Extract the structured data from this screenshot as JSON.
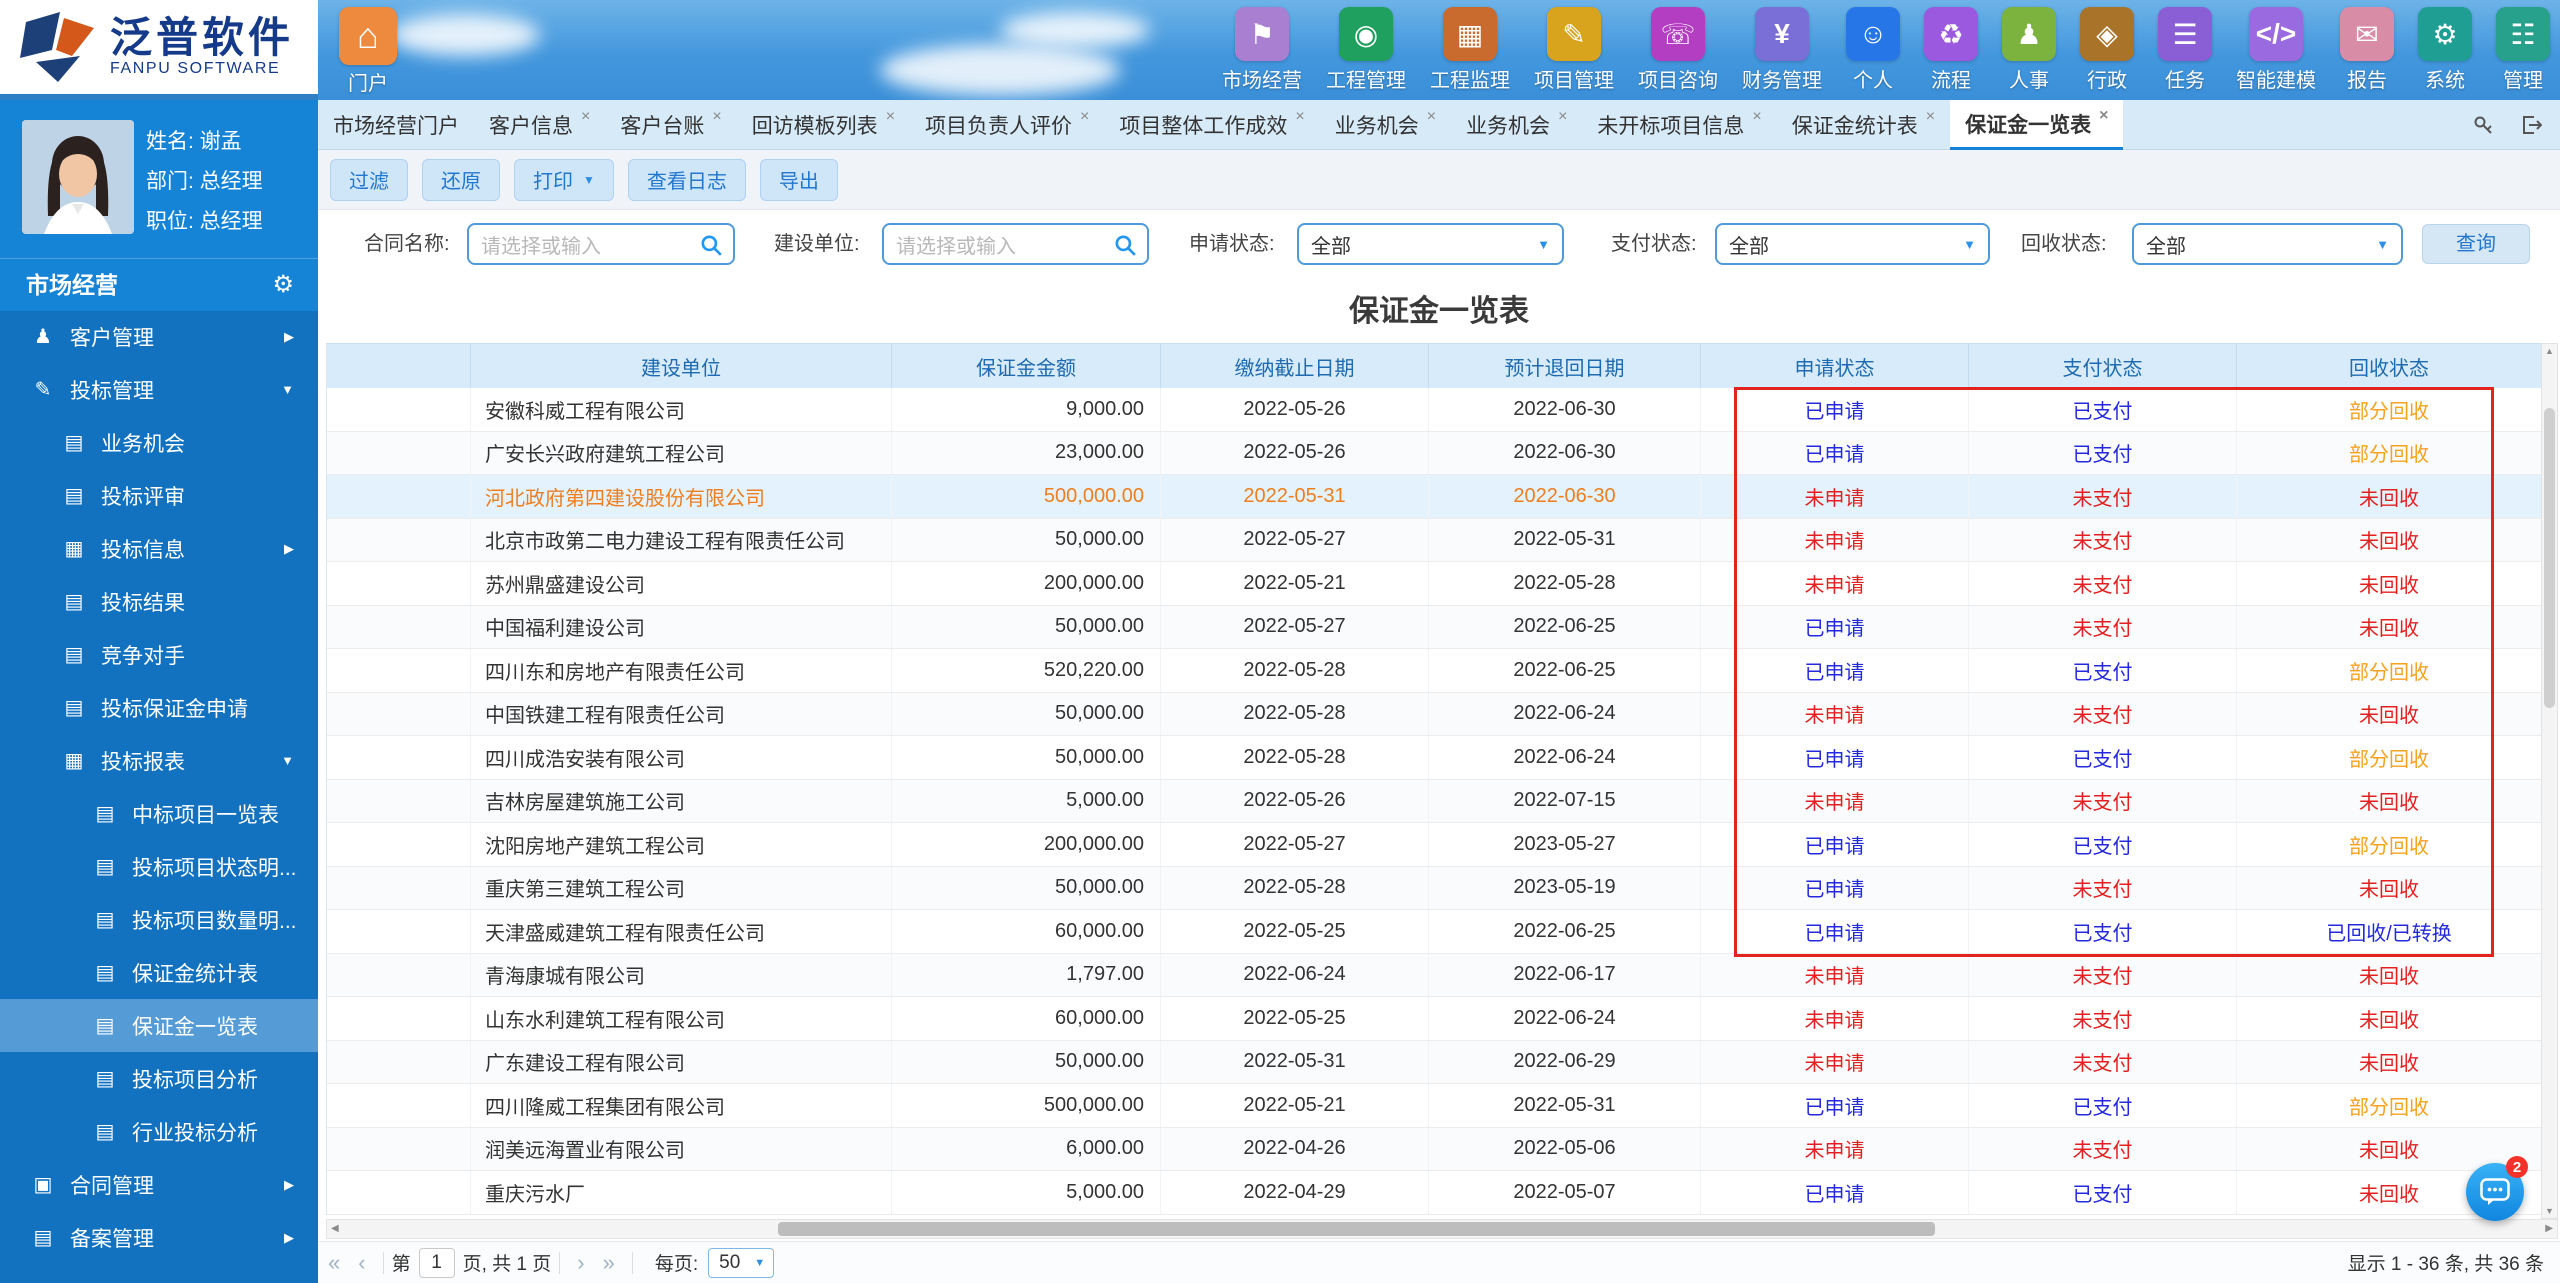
{
  "brand": {
    "logo_cn": "泛普软件",
    "logo_en": "FANPU SOFTWARE"
  },
  "topnav": {
    "portal": {
      "label": "门户",
      "color": "#ed8a3d",
      "glyph": "⌂"
    },
    "items": [
      {
        "label": "市场经营",
        "color": "#a87fd1",
        "glyph": "⚑"
      },
      {
        "label": "工程管理",
        "color": "#1fa05e",
        "glyph": "◉"
      },
      {
        "label": "工程监理",
        "color": "#c96a2e",
        "glyph": "▦"
      },
      {
        "label": "项目管理",
        "color": "#d8a31d",
        "glyph": "✎"
      },
      {
        "label": "项目咨询",
        "color": "#b43ec2",
        "glyph": "☏"
      },
      {
        "label": "财务管理",
        "color": "#7a6fd6",
        "glyph": "¥"
      },
      {
        "label": "个人",
        "color": "#2676e8",
        "glyph": "☺"
      },
      {
        "label": "流程",
        "color": "#9b59e0",
        "glyph": "♻"
      },
      {
        "label": "人事",
        "color": "#7cb23e",
        "glyph": "♟"
      },
      {
        "label": "行政",
        "color": "#a9742a",
        "glyph": "◈"
      },
      {
        "label": "任务",
        "color": "#8a5fd6",
        "glyph": "☰"
      },
      {
        "label": "智能建模",
        "color": "#9a6ae0",
        "glyph": "</>"
      },
      {
        "label": "报告",
        "color": "#d98ca6",
        "glyph": "✉"
      },
      {
        "label": "系统",
        "color": "#1f9e93",
        "glyph": "⚙"
      },
      {
        "label": "管理",
        "color": "#27a08c",
        "glyph": "☷"
      }
    ]
  },
  "user": {
    "name_label": "姓名: 谢孟",
    "dept_label": "部门: 总经理",
    "title_label": "职位: 总经理"
  },
  "sidebar": {
    "section": "市场经营",
    "items": [
      {
        "label": "客户管理",
        "level": 1,
        "icon": "♟",
        "icon_name": "customer-icon",
        "arrow": "right"
      },
      {
        "label": "投标管理",
        "level": 1,
        "icon": "✎",
        "icon_name": "edit-icon",
        "arrow": "down"
      },
      {
        "label": "业务机会",
        "level": 2,
        "icon": "▤",
        "icon_name": "file-icon"
      },
      {
        "label": "投标评审",
        "level": 2,
        "icon": "▤",
        "icon_name": "file-icon"
      },
      {
        "label": "投标信息",
        "level": 2,
        "icon": "▦",
        "icon_name": "grid-icon",
        "arrow": "right"
      },
      {
        "label": "投标结果",
        "level": 2,
        "icon": "▤",
        "icon_name": "file-icon"
      },
      {
        "label": "竞争对手",
        "level": 2,
        "icon": "▤",
        "icon_name": "file-icon"
      },
      {
        "label": "投标保证金申请",
        "level": 2,
        "icon": "▤",
        "icon_name": "file-icon"
      },
      {
        "label": "投标报表",
        "level": 2,
        "icon": "▦",
        "icon_name": "grid-icon",
        "arrow": "down"
      },
      {
        "label": "中标项目一览表",
        "level": 3,
        "icon": "▤",
        "icon_name": "file-icon"
      },
      {
        "label": "投标项目状态明...",
        "level": 3,
        "icon": "▤",
        "icon_name": "file-icon"
      },
      {
        "label": "投标项目数量明...",
        "level": 3,
        "icon": "▤",
        "icon_name": "file-icon"
      },
      {
        "label": "保证金统计表",
        "level": 3,
        "icon": "▤",
        "icon_name": "file-icon"
      },
      {
        "label": "保证金一览表",
        "level": 3,
        "icon": "▤",
        "icon_name": "file-icon",
        "selected": true
      },
      {
        "label": "投标项目分析",
        "level": 3,
        "icon": "▤",
        "icon_name": "file-icon"
      },
      {
        "label": "行业投标分析",
        "level": 3,
        "icon": "▤",
        "icon_name": "file-icon"
      },
      {
        "label": "合同管理",
        "level": 1,
        "icon": "▣",
        "icon_name": "contract-icon",
        "arrow": "right"
      },
      {
        "label": "备案管理",
        "level": 1,
        "icon": "▤",
        "icon_name": "file-icon",
        "arrow": "right"
      }
    ]
  },
  "tabbar": {
    "tabs": [
      {
        "label": "市场经营门户",
        "closable": false,
        "active": false
      },
      {
        "label": "客户信息",
        "closable": true,
        "active": false
      },
      {
        "label": "客户台账",
        "closable": true,
        "active": false
      },
      {
        "label": "回访模板列表",
        "closable": true,
        "active": false
      },
      {
        "label": "项目负责人评价",
        "closable": true,
        "active": false
      },
      {
        "label": "项目整体工作成效",
        "closable": true,
        "active": false
      },
      {
        "label": "业务机会",
        "closable": true,
        "active": false
      },
      {
        "label": "业务机会",
        "closable": true,
        "active": false
      },
      {
        "label": "未开标项目信息",
        "closable": true,
        "active": false
      },
      {
        "label": "保证金统计表",
        "closable": true,
        "active": false
      },
      {
        "label": "保证金一览表",
        "closable": true,
        "active": true
      }
    ]
  },
  "toolbar": {
    "buttons": [
      {
        "label": "过滤",
        "caret": false
      },
      {
        "label": "还原",
        "caret": false
      },
      {
        "label": "打印",
        "caret": true
      },
      {
        "label": "查看日志",
        "caret": false
      },
      {
        "label": "导出",
        "caret": false
      }
    ]
  },
  "filters": {
    "contract_label": "合同名称:",
    "contract_placeholder": "请选择或输入",
    "unit_label": "建设单位:",
    "unit_placeholder": "请选择或输入",
    "apply_label": "申请状态:",
    "apply_value": "全部",
    "pay_label": "支付状态:",
    "pay_value": "全部",
    "recover_label": "回收状态:",
    "recover_value": "全部",
    "search_button": "查询"
  },
  "page_title": "保证金一览表",
  "table": {
    "columns": [
      "",
      "建设单位",
      "保证金金额",
      "缴纳截止日期",
      "预计退回日期",
      "申请状态",
      "支付状态",
      "回收状态"
    ],
    "rows": [
      {
        "company": "安徽科威工程有限公司",
        "amount": "9,000.00",
        "deadline": "2022-05-26",
        "return_date": "2022-06-30",
        "apply": "已申请",
        "pay": "已支付",
        "recover": "部分回收",
        "highlight": false
      },
      {
        "company": "广安长兴政府建筑工程公司",
        "amount": "23,000.00",
        "deadline": "2022-05-26",
        "return_date": "2022-06-30",
        "apply": "已申请",
        "pay": "已支付",
        "recover": "部分回收",
        "highlight": false
      },
      {
        "company": "河北政府第四建设股份有限公司",
        "amount": "500,000.00",
        "deadline": "2022-05-31",
        "return_date": "2022-06-30",
        "apply": "未申请",
        "pay": "未支付",
        "recover": "未回收",
        "highlight": true
      },
      {
        "company": "北京市政第二电力建设工程有限责任公司",
        "amount": "50,000.00",
        "deadline": "2022-05-27",
        "return_date": "2022-05-31",
        "apply": "未申请",
        "pay": "未支付",
        "recover": "未回收",
        "highlight": false
      },
      {
        "company": "苏州鼎盛建设公司",
        "amount": "200,000.00",
        "deadline": "2022-05-21",
        "return_date": "2022-05-28",
        "apply": "未申请",
        "pay": "未支付",
        "recover": "未回收",
        "highlight": false
      },
      {
        "company": "中国福利建设公司",
        "amount": "50,000.00",
        "deadline": "2022-05-27",
        "return_date": "2022-06-25",
        "apply": "已申请",
        "pay": "未支付",
        "recover": "未回收",
        "highlight": false
      },
      {
        "company": "四川东和房地产有限责任公司",
        "amount": "520,220.00",
        "deadline": "2022-05-28",
        "return_date": "2022-06-25",
        "apply": "已申请",
        "pay": "已支付",
        "recover": "部分回收",
        "highlight": false
      },
      {
        "company": "中国铁建工程有限责任公司",
        "amount": "50,000.00",
        "deadline": "2022-05-28",
        "return_date": "2022-06-24",
        "apply": "未申请",
        "pay": "未支付",
        "recover": "未回收",
        "highlight": false
      },
      {
        "company": "四川成浩安装有限公司",
        "amount": "50,000.00",
        "deadline": "2022-05-28",
        "return_date": "2022-06-24",
        "apply": "已申请",
        "pay": "已支付",
        "recover": "部分回收",
        "highlight": false
      },
      {
        "company": "吉林房屋建筑施工公司",
        "amount": "5,000.00",
        "deadline": "2022-05-26",
        "return_date": "2022-07-15",
        "apply": "未申请",
        "pay": "未支付",
        "recover": "未回收",
        "highlight": false
      },
      {
        "company": "沈阳房地产建筑工程公司",
        "amount": "200,000.00",
        "deadline": "2022-05-27",
        "return_date": "2023-05-27",
        "apply": "已申请",
        "pay": "已支付",
        "recover": "部分回收",
        "highlight": false
      },
      {
        "company": "重庆第三建筑工程公司",
        "amount": "50,000.00",
        "deadline": "2022-05-28",
        "return_date": "2023-05-19",
        "apply": "已申请",
        "pay": "未支付",
        "recover": "未回收",
        "highlight": false
      },
      {
        "company": "天津盛威建筑工程有限责任公司",
        "amount": "60,000.00",
        "deadline": "2022-05-25",
        "return_date": "2022-06-25",
        "apply": "已申请",
        "pay": "已支付",
        "recover": "已回收/已转换",
        "highlight": false
      },
      {
        "company": "青海康城有限公司",
        "amount": "1,797.00",
        "deadline": "2022-06-24",
        "return_date": "2022-06-17",
        "apply": "未申请",
        "pay": "未支付",
        "recover": "未回收",
        "highlight": false
      },
      {
        "company": "山东水利建筑工程有限公司",
        "amount": "60,000.00",
        "deadline": "2022-05-25",
        "return_date": "2022-06-24",
        "apply": "未申请",
        "pay": "未支付",
        "recover": "未回收",
        "highlight": false
      },
      {
        "company": "广东建设工程有限公司",
        "amount": "50,000.00",
        "deadline": "2022-05-31",
        "return_date": "2022-06-29",
        "apply": "未申请",
        "pay": "未支付",
        "recover": "未回收",
        "highlight": false
      },
      {
        "company": "四川隆威工程集团有限公司",
        "amount": "500,000.00",
        "deadline": "2022-05-21",
        "return_date": "2022-05-31",
        "apply": "已申请",
        "pay": "已支付",
        "recover": "部分回收",
        "highlight": false
      },
      {
        "company": "润美远海置业有限公司",
        "amount": "6,000.00",
        "deadline": "2022-04-26",
        "return_date": "2022-05-06",
        "apply": "未申请",
        "pay": "未支付",
        "recover": "未回收",
        "highlight": false
      },
      {
        "company": "重庆污水厂",
        "amount": "5,000.00",
        "deadline": "2022-04-29",
        "return_date": "2022-05-07",
        "apply": "已申请",
        "pay": "已支付",
        "recover": "未回收",
        "highlight": false
      }
    ]
  },
  "pagination": {
    "first": "«",
    "prev": "‹",
    "page_prefix": "第",
    "page_value": "1",
    "page_suffix": "页, 共 1 页",
    "next": "›",
    "last": "»",
    "per_page_label": "每页:",
    "per_page_value": "50",
    "summary": "显示 1 - 36 条, 共 36 条"
  },
  "chat": {
    "badge": "2"
  },
  "colors": {
    "status_applied_blue": "#2429de",
    "status_not_red": "#e51f1f",
    "status_partial_orange": "#f6a21d",
    "highlight_row_text": "#ef7e1e",
    "red_annotation_box": "#e3231d",
    "sidebar_blue": "#1272c0",
    "active_tab_underline": "#1681d8"
  }
}
